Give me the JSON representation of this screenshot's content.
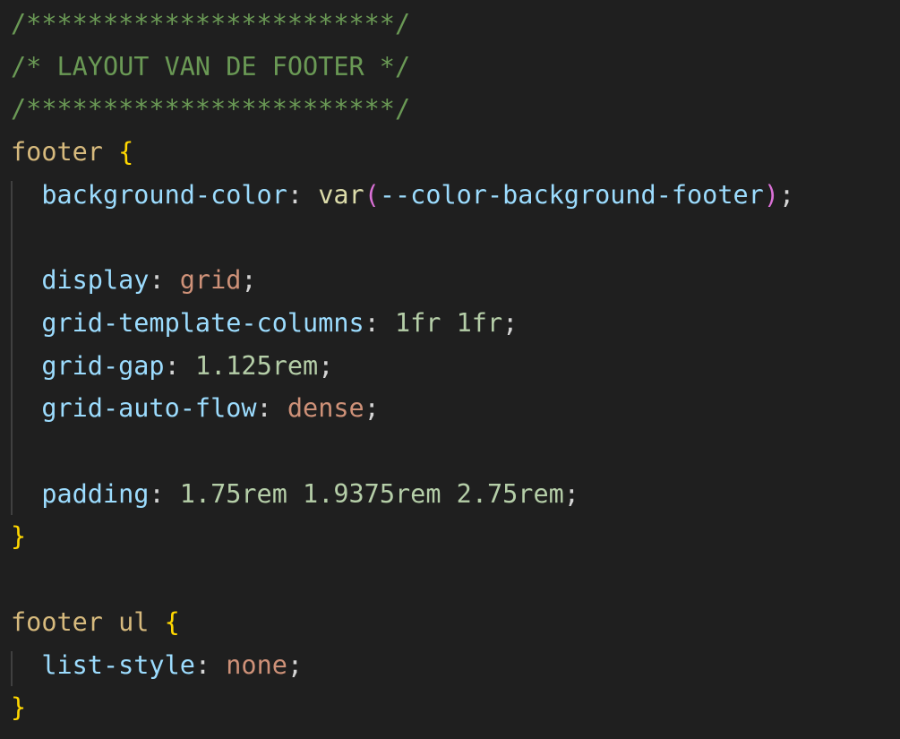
{
  "editor": {
    "language": "css",
    "colors": {
      "background": "#1f1f1f",
      "comment": "#6a9955",
      "selector": "#d7ba7d",
      "brace": "#ffd700",
      "property": "#9cdcfe",
      "punctuation": "#d4d4d4",
      "function": "#dcdcaa",
      "paren": "#da70d6",
      "value_keyword": "#ce9178",
      "number": "#b5cea8",
      "indent_guide": "#404040"
    },
    "lines": [
      {
        "tokens": [
          {
            "type": "comment",
            "text": "/************************/"
          }
        ]
      },
      {
        "tokens": [
          {
            "type": "comment",
            "text": "/* LAYOUT VAN DE FOOTER */"
          }
        ]
      },
      {
        "tokens": [
          {
            "type": "comment",
            "text": "/************************/"
          }
        ]
      },
      {
        "tokens": [
          {
            "type": "selector",
            "text": "footer"
          },
          {
            "type": "punct",
            "text": " "
          },
          {
            "type": "brace",
            "text": "{"
          }
        ]
      },
      {
        "tokens": [
          {
            "type": "punct",
            "text": "  "
          },
          {
            "type": "prop",
            "text": "background-color"
          },
          {
            "type": "punct",
            "text": ": "
          },
          {
            "type": "func",
            "text": "var"
          },
          {
            "type": "paren",
            "text": "("
          },
          {
            "type": "var",
            "text": "--color-background-footer"
          },
          {
            "type": "paren",
            "text": ")"
          },
          {
            "type": "punct",
            "text": ";"
          }
        ]
      },
      {
        "tokens": []
      },
      {
        "tokens": [
          {
            "type": "punct",
            "text": "  "
          },
          {
            "type": "prop",
            "text": "display"
          },
          {
            "type": "punct",
            "text": ": "
          },
          {
            "type": "ident",
            "text": "grid"
          },
          {
            "type": "punct",
            "text": ";"
          }
        ]
      },
      {
        "tokens": [
          {
            "type": "punct",
            "text": "  "
          },
          {
            "type": "prop",
            "text": "grid-template-columns"
          },
          {
            "type": "punct",
            "text": ": "
          },
          {
            "type": "num",
            "text": "1fr"
          },
          {
            "type": "punct",
            "text": " "
          },
          {
            "type": "num",
            "text": "1fr"
          },
          {
            "type": "punct",
            "text": ";"
          }
        ]
      },
      {
        "tokens": [
          {
            "type": "punct",
            "text": "  "
          },
          {
            "type": "prop",
            "text": "grid-gap"
          },
          {
            "type": "punct",
            "text": ": "
          },
          {
            "type": "num",
            "text": "1.125rem"
          },
          {
            "type": "punct",
            "text": ";"
          }
        ]
      },
      {
        "tokens": [
          {
            "type": "punct",
            "text": "  "
          },
          {
            "type": "prop",
            "text": "grid-auto-flow"
          },
          {
            "type": "punct",
            "text": ": "
          },
          {
            "type": "ident",
            "text": "dense"
          },
          {
            "type": "punct",
            "text": ";"
          }
        ]
      },
      {
        "tokens": []
      },
      {
        "tokens": [
          {
            "type": "punct",
            "text": "  "
          },
          {
            "type": "prop",
            "text": "padding"
          },
          {
            "type": "punct",
            "text": ": "
          },
          {
            "type": "num",
            "text": "1.75rem"
          },
          {
            "type": "punct",
            "text": " "
          },
          {
            "type": "num",
            "text": "1.9375rem"
          },
          {
            "type": "punct",
            "text": " "
          },
          {
            "type": "num",
            "text": "2.75rem"
          },
          {
            "type": "punct",
            "text": ";"
          }
        ]
      },
      {
        "tokens": [
          {
            "type": "brace",
            "text": "}"
          }
        ]
      },
      {
        "tokens": []
      },
      {
        "tokens": [
          {
            "type": "selector",
            "text": "footer"
          },
          {
            "type": "punct",
            "text": " "
          },
          {
            "type": "selector",
            "text": "ul"
          },
          {
            "type": "punct",
            "text": " "
          },
          {
            "type": "brace",
            "text": "{"
          }
        ]
      },
      {
        "tokens": [
          {
            "type": "punct",
            "text": "  "
          },
          {
            "type": "prop",
            "text": "list-style"
          },
          {
            "type": "punct",
            "text": ": "
          },
          {
            "type": "ident",
            "text": "none"
          },
          {
            "type": "punct",
            "text": ";"
          }
        ]
      },
      {
        "tokens": [
          {
            "type": "brace",
            "text": "}"
          }
        ]
      }
    ],
    "indent_guides": [
      {
        "from_line": 4,
        "to_line": 11
      },
      {
        "from_line": 15,
        "to_line": 15
      }
    ]
  }
}
